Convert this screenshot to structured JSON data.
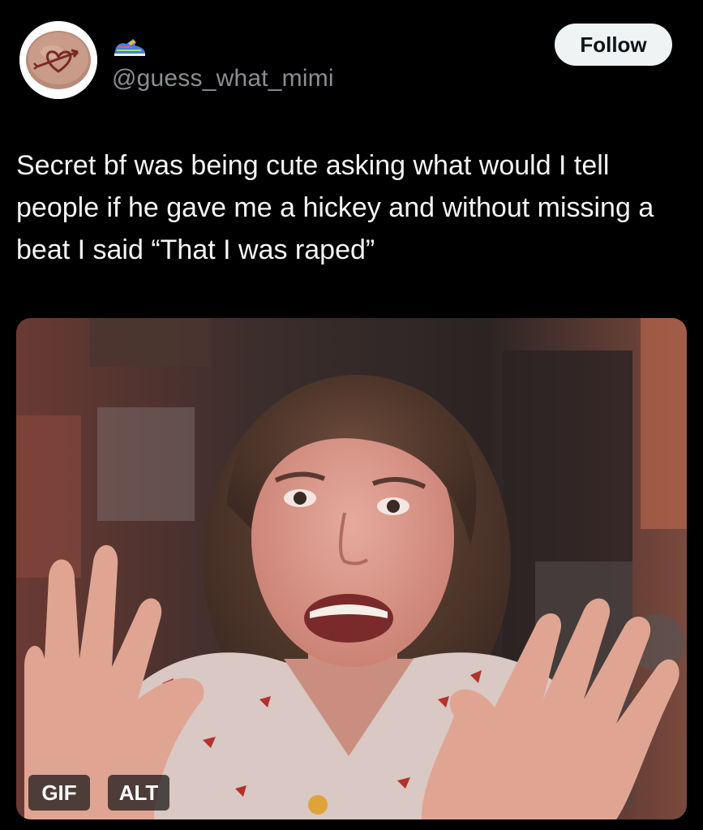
{
  "post": {
    "handle": "@guess_what_mimi",
    "follow_label": "Follow",
    "text": "Secret bf was being cute asking what would I tell people if he gave me a hickey and without missing a beat I said “That I was raped”",
    "avatar_icon": "heart-arrow-candy-icon",
    "profile_badge_icon": "sneaker-emoji-icon"
  },
  "media": {
    "gif_label": "GIF",
    "alt_label": "ALT"
  },
  "colors": {
    "background": "#000000",
    "handle": "#8a8d91",
    "follow_bg": "#eff3f4",
    "follow_text": "#0f1419"
  }
}
